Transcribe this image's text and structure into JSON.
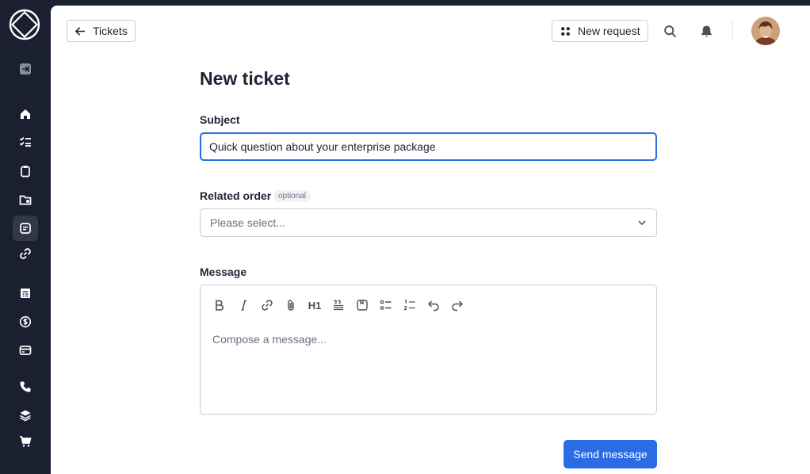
{
  "colors": {
    "sidebar_bg": "#1b2030",
    "accent": "#2a6be6",
    "border": "#c9ccd3"
  },
  "sidebar": {
    "items": [
      {
        "icon": "collapse-sidebar-icon"
      },
      {
        "icon": "home-icon"
      },
      {
        "icon": "tasks-icon"
      },
      {
        "icon": "clipboard-icon"
      },
      {
        "icon": "folder-icon"
      },
      {
        "icon": "tickets-icon",
        "active": true
      },
      {
        "icon": "link-icon"
      },
      {
        "icon": "calendar-icon"
      },
      {
        "icon": "dollar-icon"
      },
      {
        "icon": "card-icon"
      },
      {
        "icon": "phone-icon"
      },
      {
        "icon": "layers-icon"
      },
      {
        "icon": "cart-icon"
      }
    ]
  },
  "header": {
    "back_label": "Tickets",
    "new_request_label": "New request"
  },
  "form": {
    "title": "New ticket",
    "subject_label": "Subject",
    "subject_value": "Quick question about your enterprise package",
    "related_order_label": "Related order",
    "optional_badge": "optional",
    "related_order_placeholder": "Please select...",
    "message_label": "Message",
    "message_placeholder": "Compose a message...",
    "toolbar": [
      "bold-icon",
      "italic-icon",
      "link-icon",
      "attachment-icon",
      "heading-1-icon",
      "quote-icon",
      "snippet-icon",
      "bullet-list-icon",
      "numbered-list-icon",
      "undo-icon",
      "redo-icon"
    ],
    "heading_label": "H1",
    "send_label": "Send message"
  }
}
